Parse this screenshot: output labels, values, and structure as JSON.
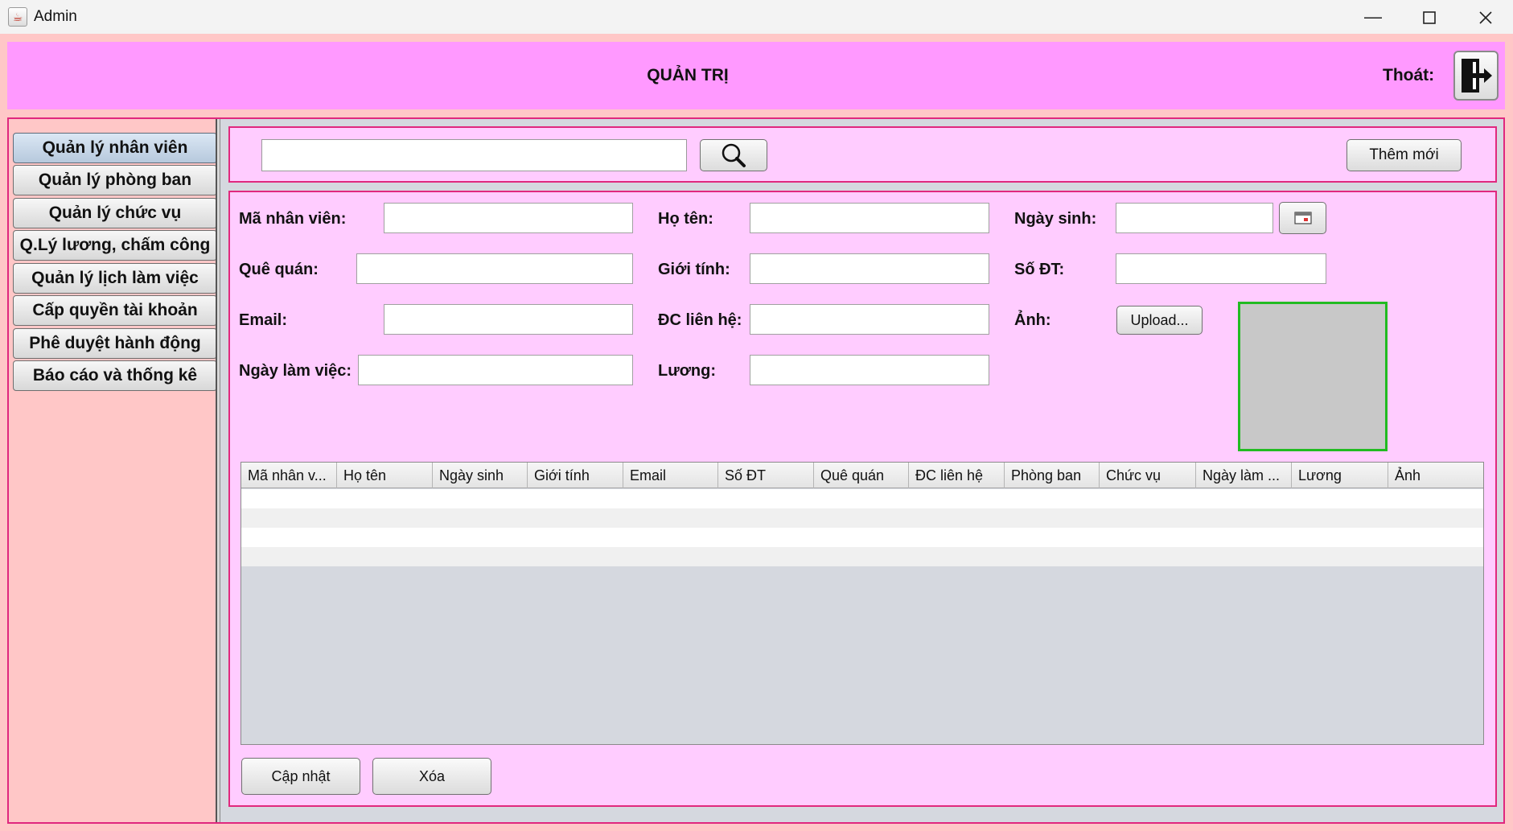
{
  "window": {
    "title": "Admin",
    "app_icon": "java-cup-icon",
    "controls": [
      "minimize-icon",
      "maximize-icon",
      "close-icon"
    ]
  },
  "header": {
    "title": "QUẢN TRỊ",
    "logout_label": "Thoát:",
    "logout_icon": "logout-door-icon"
  },
  "sidebar": {
    "items": [
      {
        "label": "Quản lý nhân viên",
        "active": true
      },
      {
        "label": "Quản lý phòng ban",
        "active": false
      },
      {
        "label": "Quản lý chức vụ",
        "active": false
      },
      {
        "label": "Q.Lý lương, chấm công",
        "active": false
      },
      {
        "label": "Quản lý lịch làm việc",
        "active": false
      },
      {
        "label": "Cấp quyền tài khoản",
        "active": false
      },
      {
        "label": "Phê duyệt hành động",
        "active": false
      },
      {
        "label": "Báo cáo và thống kê",
        "active": false
      }
    ]
  },
  "search": {
    "value": "",
    "button_icon": "search-icon",
    "add_label": "Thêm mới"
  },
  "form": {
    "employee_id_label": "Mã nhân viên:",
    "name_label": "Họ tên:",
    "birthdate_label": "Ngày sinh:",
    "hometown_label": "Quê quán:",
    "gender_label": "Giới tính:",
    "phone_label": "Số ĐT:",
    "email_label": "Email:",
    "address_label": "ĐC liên hệ:",
    "photo_label": "Ảnh:",
    "workdate_label": "Ngày làm việc:",
    "salary_label": "Lương:",
    "upload_label": "Upload...",
    "calendar_icon": "calendar-icon"
  },
  "table": {
    "columns": [
      "Mã nhân v...",
      "Họ tên",
      "Ngày sinh",
      "Giới tính",
      "Email",
      "Số ĐT",
      "Quê quán",
      "ĐC liên hệ",
      "Phòng ban",
      "Chức vụ",
      "Ngày làm ...",
      "Lương",
      "Ảnh"
    ],
    "rows": []
  },
  "actions": {
    "update_label": "Cập nhật",
    "delete_label": "Xóa"
  },
  "colors": {
    "header": "#ff99ff",
    "panel": "#ffccff",
    "background": "#ffc7c7",
    "panel_border": "#e0287e",
    "photo_border": "#22bb22"
  }
}
